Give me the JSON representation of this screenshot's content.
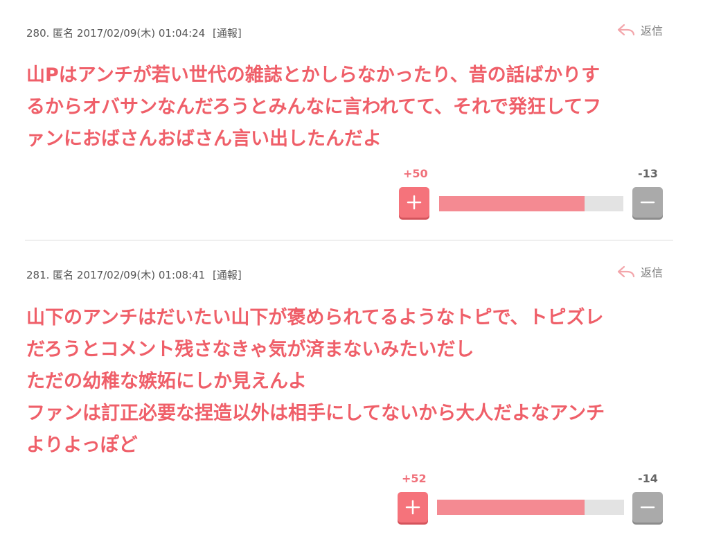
{
  "comments": [
    {
      "meta": "280. 匿名 2017/02/09(木) 01:04:24",
      "report_label": "[通報]",
      "reply_label": "返信",
      "lines": [
        "山Pはアンチが若い世代の雑誌とかしらなかったり、昔の話ばかりす",
        "るからオバサンなんだろうとみんなに言われてて、それで発狂してフ",
        "ァンにおばさんおばさん言い出したんだよ"
      ],
      "plus_count": "+50",
      "minus_count": "-13",
      "plus_ratio": 0.79
    },
    {
      "meta": "281. 匿名 2017/02/09(木) 01:08:41",
      "report_label": "[通報]",
      "reply_label": "返信",
      "lines": [
        "山下のアンチはだいたい山下が褒められてるようなトピで、トピズレ",
        "だろうとコメント残さなきゃ気が済まないみたいだし",
        "ただの幼稚な嫉妬にしか見えんよ",
        "ファンは訂正必要な捏造以外は相手にしてないから大人だよなアンチ",
        "よりよっぽど"
      ],
      "plus_count": "+52",
      "minus_count": "-14",
      "plus_ratio": 0.79
    }
  ],
  "icons": {
    "reply": "reply-arrow-icon",
    "plus": "plus-icon",
    "minus": "minus-icon"
  },
  "colors": {
    "accent": "#ef5f69",
    "plus_button": "#f5737b",
    "bar_fill": "#f48a92",
    "minus_button": "#aaaaaa"
  }
}
